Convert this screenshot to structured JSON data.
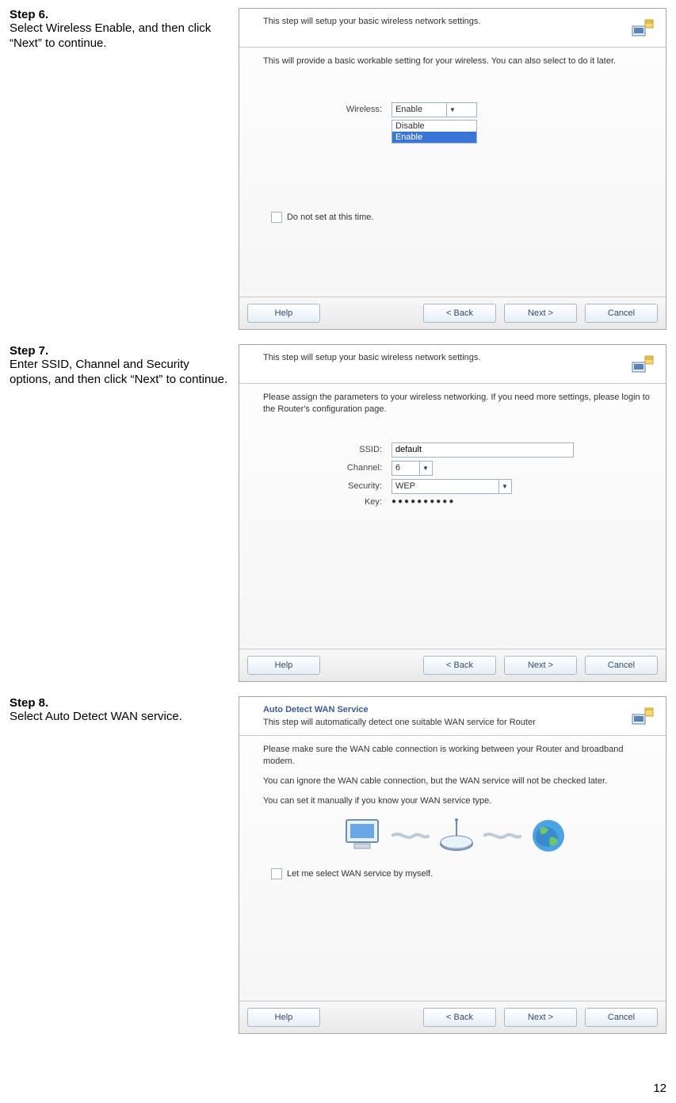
{
  "page_number": "12",
  "steps": {
    "s6": {
      "title": "Step 6.",
      "body": "Select Wireless Enable, and then click “Next” to continue."
    },
    "s7": {
      "title": "Step 7.",
      "body": "Enter SSID, Channel and Security options, and then click “Next” to continue."
    },
    "s8": {
      "title": "Step 8.",
      "body": "Select Auto Detect WAN service."
    }
  },
  "dialog6": {
    "header": "This step will setup your basic wireless network settings.",
    "desc": "This will provide a basic workable setting for your wireless. You can also select to do it later.",
    "wireless_label": "Wireless:",
    "wireless_value": "Enable",
    "options": {
      "disable": "Disable",
      "enable": "Enable"
    },
    "do_not_set": "Do not set at this time."
  },
  "dialog7": {
    "header": "This step will setup your basic wireless network settings.",
    "desc": "Please assign the parameters to your wireless networking. If you need more settings, please login to the Router's configuration page.",
    "ssid_label": "SSID:",
    "ssid_value": "default",
    "channel_label": "Channel:",
    "channel_value": "6",
    "security_label": "Security:",
    "security_value": "WEP",
    "key_label": "Key:",
    "key_value": "●●●●●●●●●●"
  },
  "dialog8": {
    "title": "Auto Detect WAN Service",
    "subtitle": "This step will automatically detect one suitable WAN service for Router",
    "p1": "Please make sure the WAN cable connection is working between your Router and broadband modem.",
    "p2": "You can ignore the WAN cable connection, but the WAN service will not be checked later.",
    "p3": "You can set it manually if you know your WAN service type.",
    "self_select": "Let me select WAN service by myself."
  },
  "buttons": {
    "help": "Help",
    "back": "< Back",
    "next": "Next >",
    "cancel": "Cancel"
  }
}
